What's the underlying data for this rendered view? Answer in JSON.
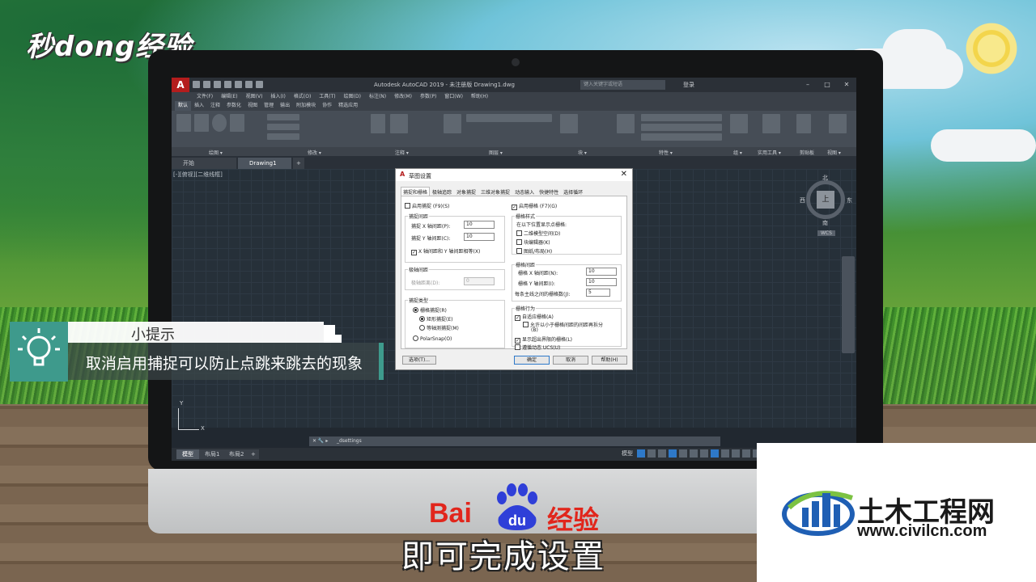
{
  "brand_logo": "秒dong经验",
  "window": {
    "app_icon": "A",
    "title": "Autodesk AutoCAD 2019 - 未注册版    Drawing1.dwg",
    "search_placeholder": "键入关键字或短语",
    "login": "登录"
  },
  "menubar": [
    "文件(F)",
    "编辑(E)",
    "视图(V)",
    "插入(I)",
    "格式(O)",
    "工具(T)",
    "绘图(D)",
    "标注(N)",
    "修改(M)",
    "参数(P)",
    "窗口(W)",
    "帮助(H)"
  ],
  "ribbon_tabs": [
    "默认",
    "插入",
    "注释",
    "参数化",
    "视图",
    "管理",
    "输出",
    "附加模块",
    "协作",
    "精选应用"
  ],
  "ribbon_panels": [
    "绘图 ▾",
    "修改 ▾",
    "注释 ▾",
    "图层 ▾",
    "块 ▾",
    "特性 ▾",
    "组 ▾",
    "实用工具 ▾",
    "剪贴板",
    "视图 ▾"
  ],
  "file_tabs": [
    "开始",
    "Drawing1"
  ],
  "viewport_label": "[-][俯视][二维线框]",
  "viewcube": {
    "north": "北",
    "south": "南",
    "west": "西",
    "east": "东",
    "face": "上",
    "ucs": "WCS"
  },
  "axis": {
    "x": "X",
    "y": "Y"
  },
  "command_line": "_dsettings",
  "layout_tabs": [
    "模型",
    "布局1",
    "布局2"
  ],
  "status_label": "模型",
  "dialog": {
    "title": "草图设置",
    "tabs": [
      "捕捉和栅格",
      "极轴追踪",
      "对象捕捉",
      "三维对象捕捉",
      "动态输入",
      "快捷特性",
      "选择循环"
    ],
    "snap_on": "启用捕捉 (F9)(S)",
    "snap_spacing_group": "捕捉间距",
    "snap_x_label": "捕捉 X 轴间距(P):",
    "snap_x_value": "10",
    "snap_y_label": "捕捉 Y 轴间距(C):",
    "snap_y_value": "10",
    "equal_xy": "X 轴间距和 Y 轴间距相等(X)",
    "polar_spacing_group": "极轴间距",
    "polar_distance_label": "极轴距离(D):",
    "polar_distance_value": "0",
    "snap_type_group": "捕捉类型",
    "grid_snap": "栅格捕捉(R)",
    "rect_snap": "矩形捕捉(E)",
    "iso_snap": "等轴测捕捉(M)",
    "polar_snap": "PolarSnap(O)",
    "grid_on": "启用栅格 (F7)(G)",
    "grid_style_group": "栅格样式",
    "grid_style_desc": "在以下位置显示点栅格:",
    "model_space": "二维模型空间(D)",
    "block_editor": "块编辑器(K)",
    "sheet_layout": "图纸/布局(H)",
    "grid_spacing_group": "栅格间距",
    "grid_x_label": "栅格 X 轴间距(N):",
    "grid_x_value": "10",
    "grid_y_label": "栅格 Y 轴间距(I):",
    "grid_y_value": "10",
    "major_line_label": "每条主线之间的栅格数(J):",
    "major_line_value": "5",
    "grid_behavior_group": "栅格行为",
    "adaptive_grid": "自适应栅格(A)",
    "allow_subdivision_1": "允许以小于栅格间距的间距再拆分",
    "allow_subdivision_2": "(B)",
    "beyond_limits": "显示超出界限的栅格(L)",
    "follow_ucs": "遵循动态 UCS(U)",
    "options_button": "选项(T)...",
    "ok_button": "确定",
    "cancel_button": "取消",
    "help_button": "帮助(H)"
  },
  "tip": {
    "heading": "小提示",
    "body": "取消启用捕捉可以防止点跳来跳去的现象"
  },
  "baidu": {
    "bai": "Bai",
    "du": "du",
    "jingyan": "经验"
  },
  "subtitle": "即可完成设置",
  "civil": {
    "name": "土木工程网",
    "url": "www.civilcn.com"
  },
  "colors": {
    "accent_teal": "#3e9a8c",
    "baidu_red": "#e1261c",
    "autocad_red": "#b41d1d",
    "civil_blue": "#1f5fb4",
    "civil_green": "#7cc242"
  }
}
